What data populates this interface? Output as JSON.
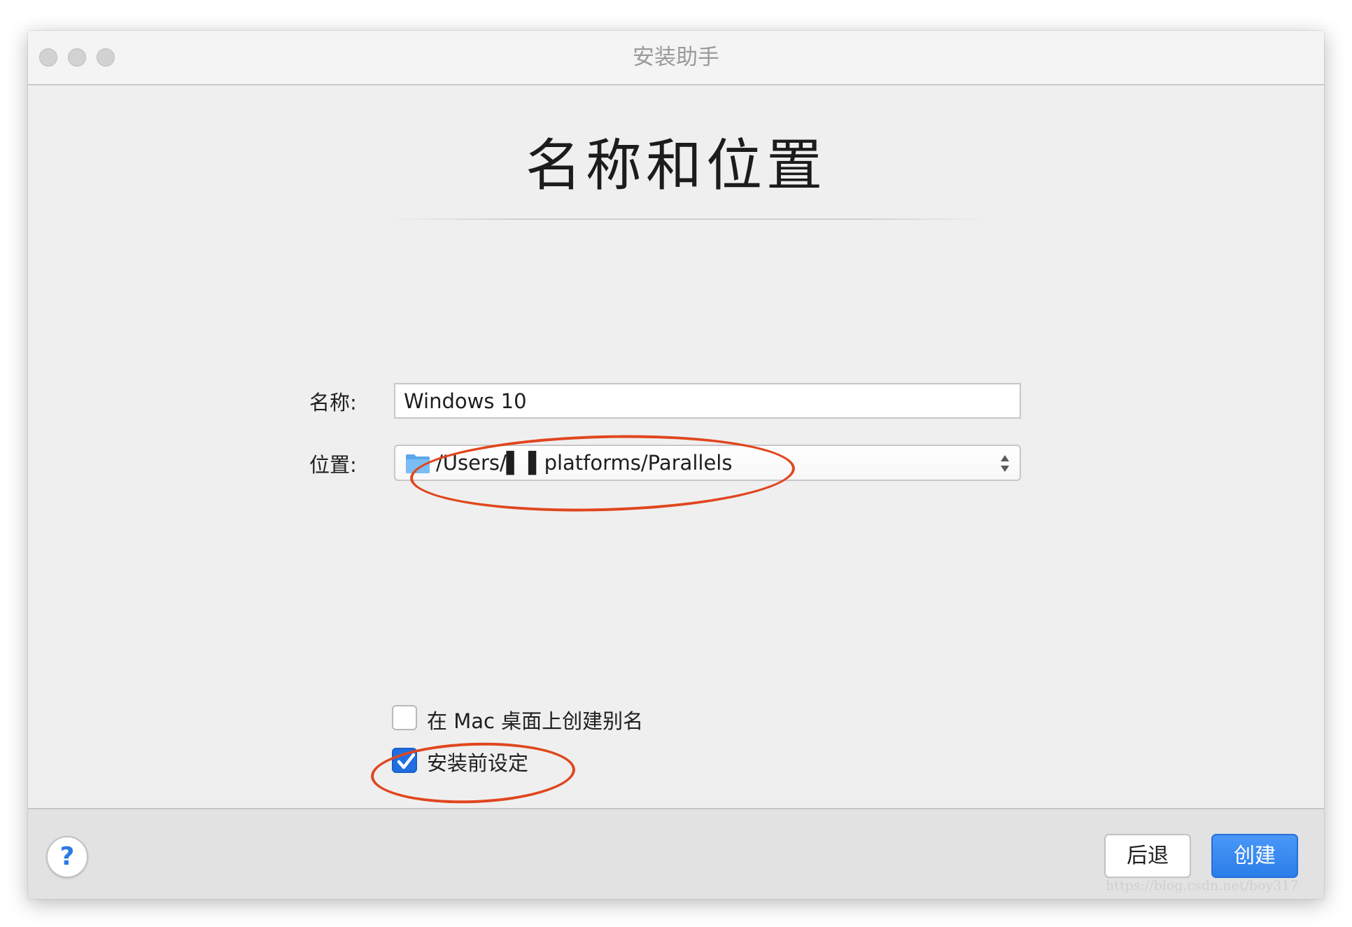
{
  "window": {
    "title": "安装助手"
  },
  "page": {
    "title": "名称和位置"
  },
  "form": {
    "name_label": "名称:",
    "name_value": "Windows 10",
    "location_label": "位置:",
    "location_value": "/Users/▌ ▌platforms/Parallels",
    "location_icon": "folder-icon"
  },
  "options": {
    "desktop_alias_label": "在 Mac 桌面上创建别名",
    "desktop_alias_checked": false,
    "configure_before_install_label": "安装前设定",
    "configure_before_install_checked": true
  },
  "footer": {
    "help_label": "?",
    "back_label": "后退",
    "create_label": "创建"
  },
  "watermark": "https://blog.csdn.net/boy317",
  "colors": {
    "accent": "#2b7ee9",
    "annotation": "#e0461e",
    "window_bg": "#efefef",
    "footer_bg": "#e2e2e2"
  }
}
